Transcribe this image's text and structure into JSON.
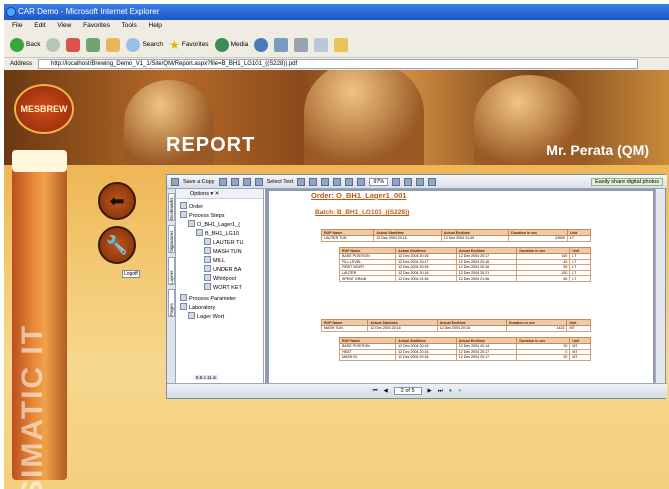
{
  "browser": {
    "title": "CAR Demo - Microsoft Internet Explorer",
    "menu": [
      "File",
      "Edit",
      "View",
      "Favorites",
      "Tools",
      "Help"
    ],
    "toolbar": {
      "back": "Back",
      "search": "Search",
      "favorites": "Favorites",
      "media": "Media"
    },
    "address_label": "Address",
    "address": "http://localhost/Brewing_Demo_V1_1/Site/QM/Report.aspx?file=B_BH1_LG101_((S228)).pdf"
  },
  "site": {
    "logo": "MESBREW",
    "section_title": "REPORT",
    "user": "Mr. Perata (QM)",
    "brand_vertical": "SIMATIC IT",
    "small_label": "Logoff"
  },
  "pdf": {
    "toolbar": {
      "save_copy": "Save a Copy",
      "select_text": "Select Text",
      "zoom": "97%",
      "digital_photos": "Easily share digital photos"
    },
    "side_tabs": [
      "Bookmarks",
      "Signatures",
      "Layers",
      "Pages"
    ],
    "options": "Options",
    "bookmarks": [
      {
        "label": "Order",
        "level": 0
      },
      {
        "label": "Process Steps",
        "level": 0
      },
      {
        "label": "O_BH1_Lager1_(",
        "level": 1
      },
      {
        "label": "B_BH1_LG10",
        "level": 2
      },
      {
        "label": "LAUTER TU",
        "level": 3
      },
      {
        "label": "MASH TUN",
        "level": 3
      },
      {
        "label": "MILL",
        "level": 3
      },
      {
        "label": "UNDER BA",
        "level": 3
      },
      {
        "label": "Whirlpool",
        "level": 3
      },
      {
        "label": "WORT KET",
        "level": 3
      },
      {
        "label": "Process Parameter",
        "level": 0
      },
      {
        "label": "Laboratory",
        "level": 0
      },
      {
        "label": "Lager Wort",
        "level": 1
      }
    ],
    "page_size": "8.5 x 11 in",
    "order_title": "Order: O_BH1_Lager1_001",
    "batch_title": "Batch: B_BH1_LG101_((S228))",
    "page_indicator": "2 of 5",
    "table_headers": [
      "RUP Name",
      "Actual Starttime",
      "Actual Endtime",
      "Duration in sec",
      "Unit"
    ],
    "table_lauter": [
      [
        "LAUTER TUN",
        "12 Dec 2004 20:16",
        "12 Dec 2004 21:49",
        "23000",
        "LT"
      ]
    ],
    "table_lauter_steps": [
      [
        "BASE POSITION",
        "12 Dec 2004 20:16",
        "12 Dec 2004 20:17",
        "100",
        "LT"
      ],
      [
        "FILL LEVEL",
        "12 Dec 2004 20:17",
        "12 Dec 2004 20:16",
        "40",
        "LT"
      ],
      [
        "FIRST WORT",
        "12 Dec 2004 20:16",
        "12 Dec 2004 20:16",
        "55",
        "LT"
      ],
      [
        "LAUTER",
        "12 Dec 2004 20:16",
        "12 Dec 2004 20:21",
        "100",
        "LT"
      ],
      [
        "SPENT GRAIN",
        "12 Dec 2004 21:46",
        "12 Dec 2004 21:46",
        "50",
        "LT"
      ]
    ],
    "table_mash": [
      [
        "MASH TUN",
        "12 Dec 2004 20:16",
        "12 Dec 2004 20:16",
        "1415",
        "MT"
      ]
    ],
    "table_mash_steps": [
      [
        "BASE POSITION",
        "12 Dec 2004 20:16",
        "12 Dec 2004 20:14",
        "20",
        "MT"
      ],
      [
        "HEAT",
        "12 Dec 2004 20:16",
        "12 Dec 2004 20:17",
        "0",
        "MT"
      ],
      [
        "MASH IN",
        "12 Dec 2004 20:16",
        "12 Dec 2004 20:17",
        "20",
        "MT"
      ]
    ]
  }
}
